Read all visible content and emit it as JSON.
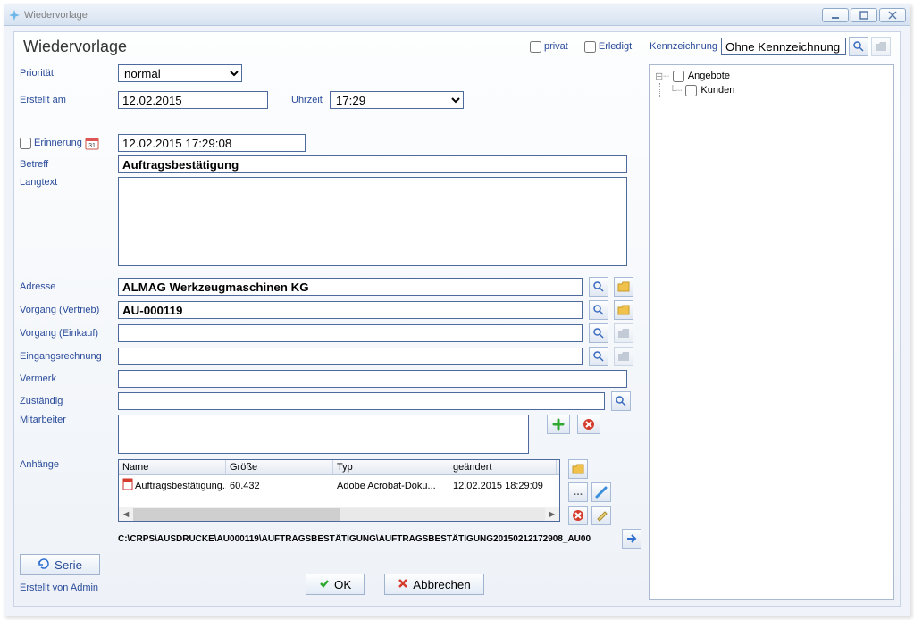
{
  "window": {
    "title": "Wiedervorlage"
  },
  "header": {
    "page_title": "Wiedervorlage",
    "privat_label": "privat",
    "erledigt_label": "Erledigt",
    "kennz_label": "Kennzeichnung",
    "kennz_value": "Ohne Kennzeichnung"
  },
  "tree": {
    "item1": "Angebote",
    "item2": "Kunden"
  },
  "labels": {
    "prio": "Priorität",
    "erstellt": "Erstellt am",
    "uhrzeit": "Uhrzeit",
    "erinnerung": "Erinnerung",
    "betreff": "Betreff",
    "langtext": "Langtext",
    "adresse": "Adresse",
    "vorgang_v": "Vorgang (Vertrieb)",
    "vorgang_e": "Vorgang (Einkauf)",
    "eingang": "Eingangsrechnung",
    "vermerk": "Vermerk",
    "zustaendig": "Zuständig",
    "mitarbeiter": "Mitarbeiter",
    "anhaenge": "Anhänge"
  },
  "values": {
    "prio": "normal",
    "datum": "12.02.2015",
    "uhrzeit": "17:29",
    "erinnerung": "12.02.2015 17:29:08",
    "betreff": "Auftragsbestätigung",
    "langtext": "",
    "adresse": "ALMAG Werkzeugmaschinen KG",
    "vorgang_v": "AU-000119",
    "vorgang_e": "",
    "eingang": "",
    "vermerk": "",
    "zustaendig": ""
  },
  "attachments": {
    "hdr_name": "Name",
    "hdr_size": "Größe",
    "hdr_type": "Typ",
    "hdr_date": "geändert",
    "row": {
      "name": "Auftragsbestätigung...",
      "size": "60.432",
      "type": "Adobe Acrobat-Doku...",
      "date": "12.02.2015 18:29:09"
    },
    "path": "C:\\CRPS\\AUSDRUCKE\\AU000119\\AUFTRAGSBESTÄTIGUNG\\AUFTRAGSBESTÄTIGUNG20150212172908_AU00"
  },
  "footer": {
    "serie": "Serie",
    "created": "Erstellt von Admin",
    "ok": "OK",
    "cancel": "Abbrechen"
  }
}
